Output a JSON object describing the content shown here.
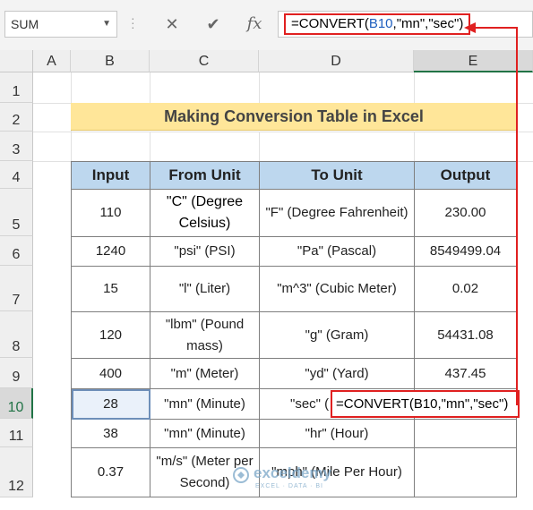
{
  "name_box": {
    "value": "SUM"
  },
  "formula_bar": {
    "cancel_icon": "✕",
    "enter_icon": "✔",
    "fx_label": "fx",
    "formula_prefix": "=CONVERT(",
    "formula_ref": "B10",
    "formula_suffix": ",\"mn\",\"sec\")"
  },
  "columns": [
    "A",
    "B",
    "C",
    "D",
    "E"
  ],
  "rows": [
    "1",
    "2",
    "3",
    "4",
    "5",
    "6",
    "7",
    "8",
    "9",
    "10",
    "11",
    "12"
  ],
  "title": "Making Conversion Table in Excel",
  "table": {
    "headers": [
      "Input",
      "From Unit",
      "To Unit",
      "Output"
    ],
    "rows": [
      {
        "input": "110",
        "from": "\"C\" (Degree Celsius)",
        "to": "\"F\" (Degree Fahrenheit)",
        "output": "230.00"
      },
      {
        "input": "1240",
        "from": "\"psi\" (PSI)",
        "to": "\"Pa\" (Pascal)",
        "output": "8549499.04"
      },
      {
        "input": "15",
        "from": "\"l\" (Liter)",
        "to": "\"m^3\" (Cubic Meter)",
        "output": "0.02"
      },
      {
        "input": "120",
        "from": "\"lbm\" (Pound mass)",
        "to": "\"g\" (Gram)",
        "output": "54431.08"
      },
      {
        "input": "400",
        "from": "\"m\" (Meter)",
        "to": "\"yd\" (Yard)",
        "output": "437.45"
      },
      {
        "input": "28",
        "from": "\"mn\" (Minute)",
        "to": "\"sec\" (",
        "output": ""
      },
      {
        "input": "38",
        "from": "\"mn\" (Minute)",
        "to": "\"hr\" (Hour)",
        "output": ""
      },
      {
        "input": "0.37",
        "from": "\"m/s\" (Meter per Second)",
        "to": "\"mph\" (Mile Per Hour)",
        "output": ""
      }
    ]
  },
  "callout": {
    "text": "=CONVERT(B10,\"mn\",\"sec\")"
  },
  "watermark": {
    "name": "exceldemy",
    "tagline": "EXCEL · DATA · BI"
  },
  "colors": {
    "header_fill": "#bdd7ee",
    "title_fill": "#ffe699",
    "highlight": "#e02020",
    "excel_green": "#217346"
  }
}
